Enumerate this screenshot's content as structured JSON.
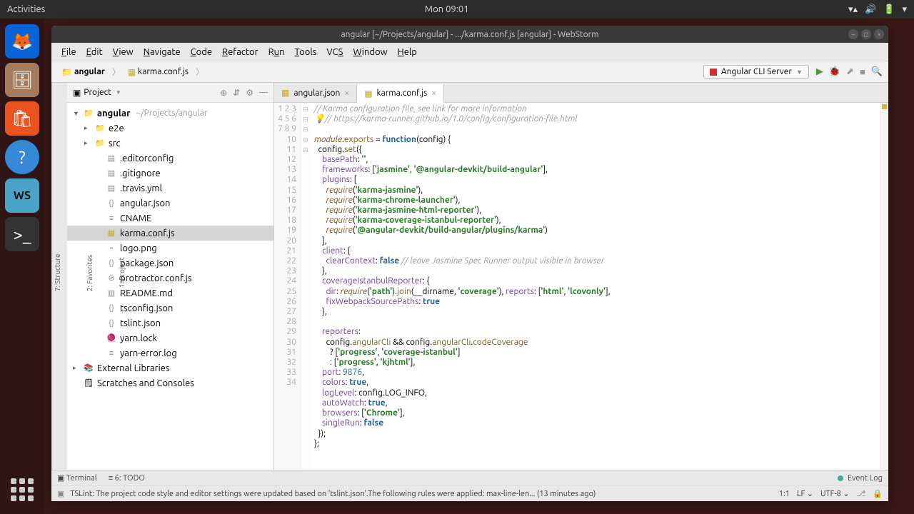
{
  "ubuntu": {
    "activities": "Activities",
    "clock": "Mon 09:01"
  },
  "window": {
    "title": "angular [~/Projects/angular] - .../karma.conf.js [angular] - WebStorm"
  },
  "menu": [
    "File",
    "Edit",
    "View",
    "Navigate",
    "Code",
    "Refactor",
    "Run",
    "Tools",
    "VCS",
    "Window",
    "Help"
  ],
  "breadcrumb": {
    "root": "angular",
    "file": "karma.conf.js"
  },
  "run_config": "Angular CLI Server",
  "project_panel": {
    "title": "Project",
    "root": "angular",
    "root_path": "~/Projects/angular",
    "children": [
      {
        "type": "folder",
        "name": "e2e"
      },
      {
        "type": "folder",
        "name": "src"
      },
      {
        "type": "file",
        "name": ".editorconfig",
        "icon": "cfg"
      },
      {
        "type": "file",
        "name": ".gitignore",
        "icon": "cfg"
      },
      {
        "type": "file",
        "name": ".travis.yml",
        "icon": "cfg"
      },
      {
        "type": "file",
        "name": "angular.json",
        "icon": "json"
      },
      {
        "type": "file",
        "name": "CNAME",
        "icon": "txt"
      },
      {
        "type": "file",
        "name": "karma.conf.js",
        "icon": "js",
        "selected": true
      },
      {
        "type": "file",
        "name": "logo.png",
        "icon": "img"
      },
      {
        "type": "file",
        "name": "package.json",
        "icon": "json"
      },
      {
        "type": "file",
        "name": "protractor.conf.js",
        "icon": "js_err"
      },
      {
        "type": "file",
        "name": "README.md",
        "icon": "md"
      },
      {
        "type": "file",
        "name": "tsconfig.json",
        "icon": "json"
      },
      {
        "type": "file",
        "name": "tslint.json",
        "icon": "json"
      },
      {
        "type": "file",
        "name": "yarn.lock",
        "icon": "yarn"
      },
      {
        "type": "file",
        "name": "yarn-error.log",
        "icon": "txt"
      }
    ],
    "ext_libs": "External Libraries",
    "scratches": "Scratches and Consoles"
  },
  "tabs": [
    {
      "name": "angular.json",
      "active": false
    },
    {
      "name": "karma.conf.js",
      "active": true
    }
  ],
  "bottom": {
    "terminal": "Terminal",
    "todo": "6: TODO",
    "eventlog": "Event Log"
  },
  "status": {
    "msg": "TSLint: The project code style and editor settings were updated based on 'tslint.json'.The following rules were applied: max-line-len... (13 minutes ago)",
    "pos": "1:1",
    "le": "LF",
    "enc": "UTF-8"
  },
  "left_tabs": {
    "project": "1: Project",
    "favorites": "2: Favorites",
    "structure": "7: Structure"
  },
  "code_lines": 34
}
